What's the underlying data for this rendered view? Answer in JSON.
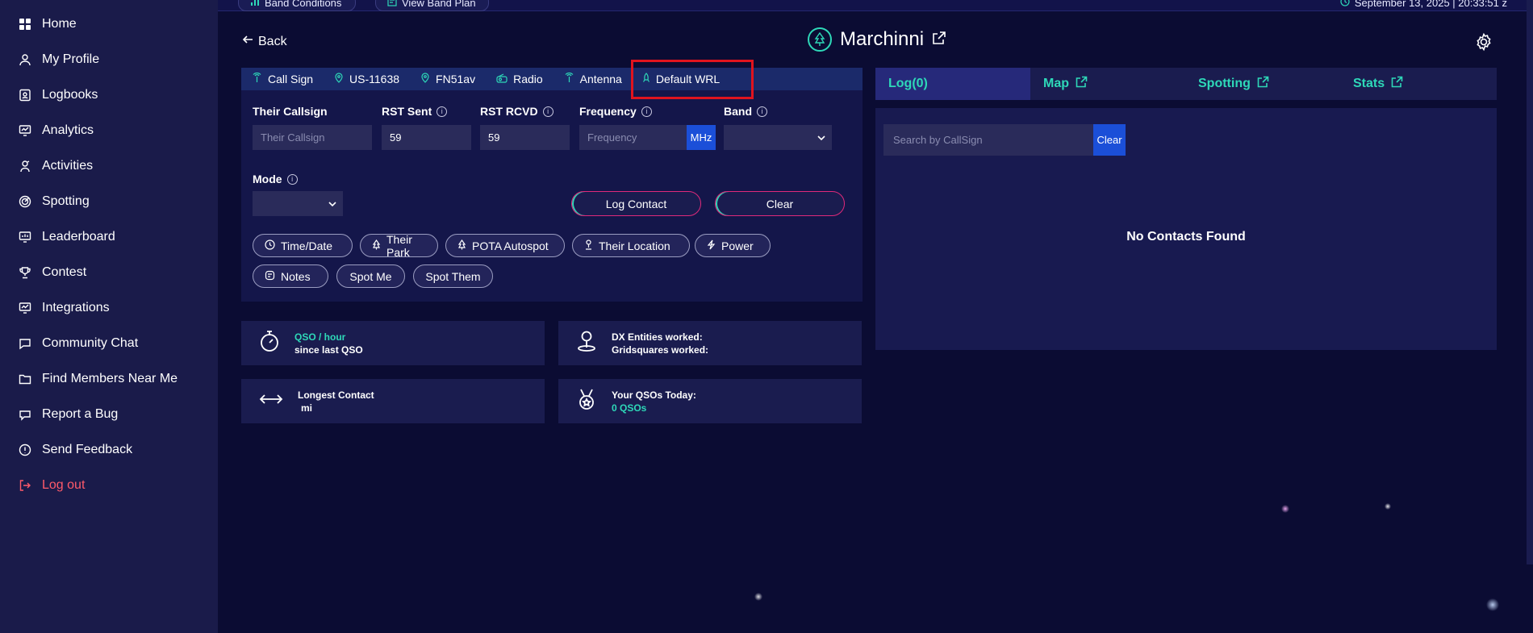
{
  "sidebar": {
    "items": [
      {
        "label": "Home",
        "icon": "grid-icon"
      },
      {
        "label": "My Profile",
        "icon": "user-icon"
      },
      {
        "label": "Logbooks",
        "icon": "logbook-icon"
      },
      {
        "label": "Analytics",
        "icon": "analytics-icon"
      },
      {
        "label": "Activities",
        "icon": "activities-icon"
      },
      {
        "label": "Spotting",
        "icon": "radar-icon"
      },
      {
        "label": "Leaderboard",
        "icon": "leaderboard-icon"
      },
      {
        "label": "Contest",
        "icon": "trophy-icon"
      },
      {
        "label": "Integrations",
        "icon": "integrations-icon"
      },
      {
        "label": "Community Chat",
        "icon": "chat-icon"
      },
      {
        "label": "Find Members Near Me",
        "icon": "folder-icon"
      },
      {
        "label": "Report a Bug",
        "icon": "bug-icon"
      },
      {
        "label": "Send Feedback",
        "icon": "feedback-icon"
      },
      {
        "label": "Log out",
        "icon": "logout-icon"
      }
    ]
  },
  "topbar": {
    "band_conditions": "Band Conditions",
    "view_band_plan": "View Band Plan",
    "datetime": "September 13, 2025 | 20:33:51 z"
  },
  "header": {
    "back_label": "Back",
    "title": "Marchinni"
  },
  "log_tabs": [
    "Call Sign",
    "US-11638",
    "FN51av",
    "Radio",
    "Antenna",
    "Default WRL"
  ],
  "form": {
    "their_callsign_label": "Their Callsign",
    "their_callsign_placeholder": "Their Callsign",
    "rst_sent_label": "RST Sent",
    "rst_sent_value": "59",
    "rst_rcvd_label": "RST RCVD",
    "rst_rcvd_value": "59",
    "frequency_label": "Frequency",
    "frequency_placeholder": "Frequency",
    "frequency_unit": "MHz",
    "band_label": "Band",
    "mode_label": "Mode",
    "log_contact": "Log Contact",
    "clear": "Clear"
  },
  "chips": [
    "Time/Date",
    "Their Park",
    "POTA Autospot",
    "Their Location",
    "Power",
    "Notes",
    "Spot Me",
    "Spot Them"
  ],
  "stats": {
    "qso_hour": "QSO / hour",
    "since_last": "since last QSO",
    "dx_entities": "DX Entities worked:",
    "gridsquares": "Gridsquares worked:",
    "longest_contact": "Longest Contact",
    "longest_unit": "mi",
    "qsos_today_label": "Your QSOs Today:",
    "qsos_today_value": "0 QSOs"
  },
  "right": {
    "tabs": [
      "Log(0)",
      "Map",
      "Spotting",
      "Stats"
    ],
    "search_placeholder": "Search by CallSign",
    "clear": "Clear",
    "empty": "No Contacts Found"
  },
  "colors": {
    "accent_teal": "#2ed8b8",
    "brand_blue": "#1b4fd8",
    "logout_red": "#ff5a6a",
    "highlight_red": "#e0141e"
  }
}
